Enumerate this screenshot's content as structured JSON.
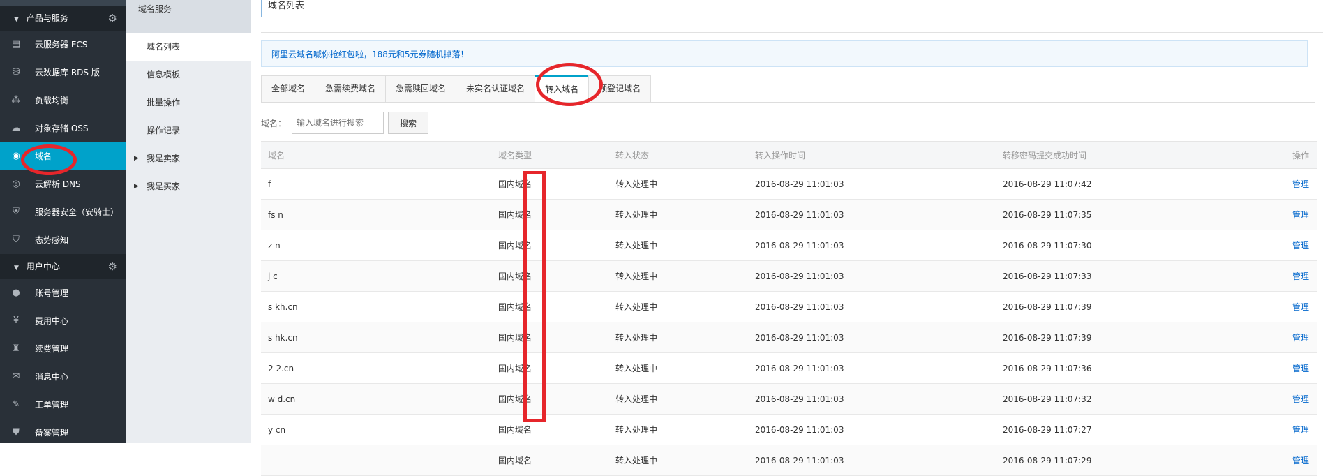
{
  "sidebar": {
    "groups": [
      {
        "title": "产品与服务",
        "items": [
          {
            "label": "云服务器 ECS",
            "icon": "server-icon"
          },
          {
            "label": "云数据库 RDS 版",
            "icon": "database-icon"
          },
          {
            "label": "负载均衡",
            "icon": "load-balancer-icon"
          },
          {
            "label": "对象存储 OSS",
            "icon": "cloud-storage-icon"
          },
          {
            "label": "域名",
            "icon": "globe-icon",
            "active": true
          },
          {
            "label": "云解析 DNS",
            "icon": "dns-icon"
          },
          {
            "label": "服务器安全（安骑士）",
            "icon": "shield-icon"
          },
          {
            "label": "态势感知",
            "icon": "shield-check-icon"
          }
        ]
      },
      {
        "title": "用户中心",
        "items": [
          {
            "label": "账号管理",
            "icon": "user-icon"
          },
          {
            "label": "费用中心",
            "icon": "yen-icon"
          },
          {
            "label": "续费管理",
            "icon": "renew-icon"
          },
          {
            "label": "消息中心",
            "icon": "mail-icon"
          },
          {
            "label": "工单管理",
            "icon": "pencil-icon"
          },
          {
            "label": "备案管理",
            "icon": "record-icon"
          }
        ]
      }
    ]
  },
  "subnav": {
    "title": "域名服务",
    "items": [
      {
        "label": "域名列表",
        "active": true
      },
      {
        "label": "信息模板"
      },
      {
        "label": "批量操作"
      },
      {
        "label": "操作记录"
      },
      {
        "label": "我是卖家",
        "expandable": true
      },
      {
        "label": "我是买家",
        "expandable": true
      }
    ]
  },
  "page": {
    "title": "域名列表",
    "notice": "阿里云域名喊你抢红包啦，188元和5元券随机掉落！"
  },
  "tabs": [
    "全部域名",
    "急需续费域名",
    "急需赎回域名",
    "未实名认证域名",
    "转入域名",
    "预登记域名"
  ],
  "active_tab": "转入域名",
  "search": {
    "label": "域名：",
    "placeholder": "输入域名进行搜索",
    "button": "搜索"
  },
  "table": {
    "headers": [
      "域名",
      "域名类型",
      "转入状态",
      "转入操作时间",
      "转移密码提交成功时间",
      "操作"
    ],
    "rows": [
      [
        "f",
        "国内域名",
        "转入处理中",
        "2016-08-29 11:01:03",
        "2016-08-29 11:07:42",
        "管理"
      ],
      [
        "fs   n",
        "国内域名",
        "转入处理中",
        "2016-08-29 11:01:03",
        "2016-08-29 11:07:35",
        "管理"
      ],
      [
        "z      n",
        "国内域名",
        "转入处理中",
        "2016-08-29 11:01:03",
        "2016-08-29 11:07:30",
        "管理"
      ],
      [
        "j       c",
        "国内域名",
        "转入处理中",
        "2016-08-29 11:01:03",
        "2016-08-29 11:07:33",
        "管理"
      ],
      [
        "s       kh.cn",
        "国内域名",
        "转入处理中",
        "2016-08-29 11:01:03",
        "2016-08-29 11:07:39",
        "管理"
      ],
      [
        "s       hk.cn",
        "国内域名",
        "转入处理中",
        "2016-08-29 11:01:03",
        "2016-08-29 11:07:39",
        "管理"
      ],
      [
        "2       2.cn",
        "国内域名",
        "转入处理中",
        "2016-08-29 11:01:03",
        "2016-08-29 11:07:36",
        "管理"
      ],
      [
        "w       d.cn",
        "国内域名",
        "转入处理中",
        "2016-08-29 11:01:03",
        "2016-08-29 11:07:32",
        "管理"
      ],
      [
        "y       cn",
        "国内域名",
        "转入处理中",
        "2016-08-29 11:01:03",
        "2016-08-29 11:07:27",
        "管理"
      ],
      [
        "",
        "国内域名",
        "转入处理中",
        "2016-08-29 11:01:03",
        "2016-08-29 11:07:29",
        "管理"
      ]
    ]
  },
  "colors": {
    "sidebar_bg": "#293038",
    "sidebar_active": "#00a2ca",
    "link": "#0066cc",
    "annotation_red": "#e6262b"
  }
}
